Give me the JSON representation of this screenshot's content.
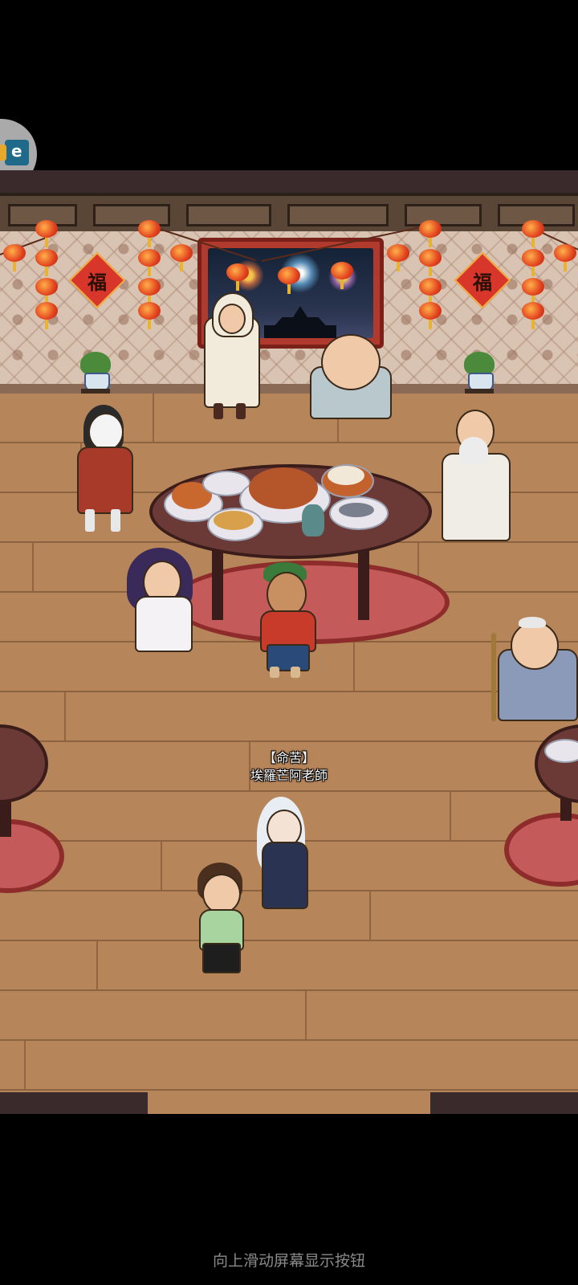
{
  "player_tag": {
    "title": "【命苦】",
    "name": "埃羅芒阿老師"
  },
  "system_hint": "向上滑动屏幕显示按钮",
  "decor": {
    "fu_character": "福",
    "floating_button_icon": "app-shortcut-icon"
  },
  "colors": {
    "background": "#000000",
    "floor": "#b7855a",
    "wallpaper": "#d9c3b2",
    "lantern": "#e2421e",
    "rug": "#c45a5a",
    "table": "#6b3a36"
  }
}
